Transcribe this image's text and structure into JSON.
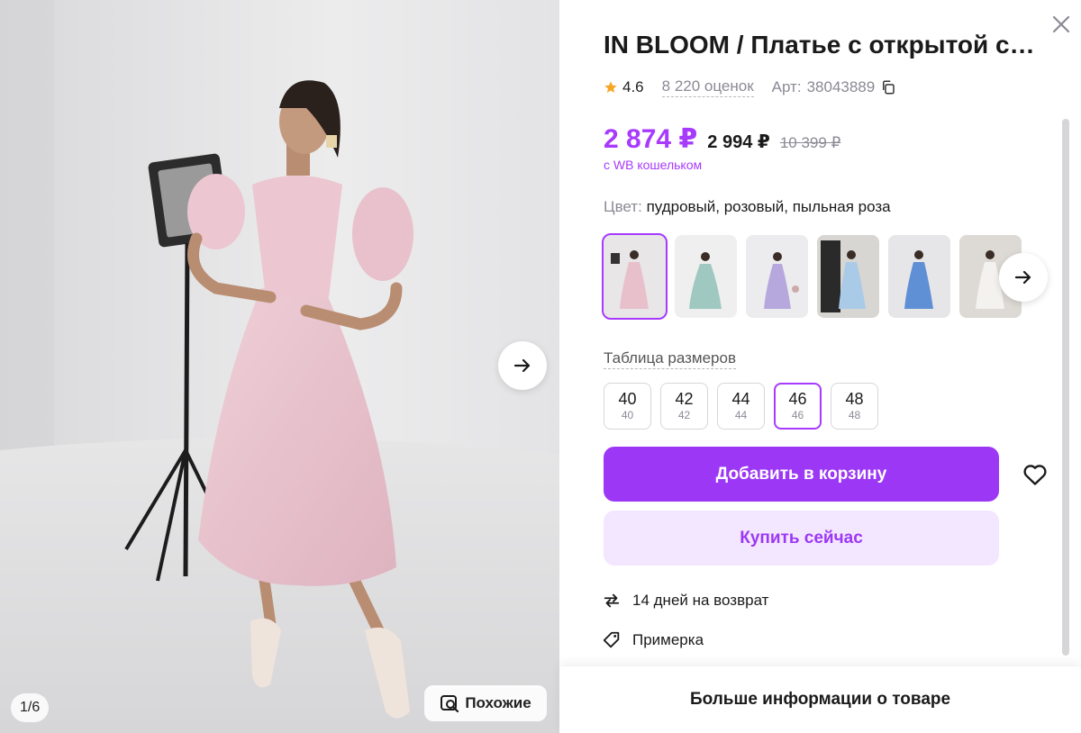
{
  "gallery": {
    "counter": "1/6",
    "similar_label": "Похожие",
    "next_icon": "arrow-right-icon",
    "similar_icon": "image-search-icon"
  },
  "product": {
    "title": "IN BLOOM / Платье с открытой спиной",
    "rating": "4.6",
    "reviews": "8 220 оценок",
    "article_label": "Арт:",
    "article": "38043889",
    "price_main": "2 874 ₽",
    "price_second": "2 994 ₽",
    "price_old": "10 399 ₽",
    "wallet_note": "с WB кошельком",
    "color_label": "Цвет:",
    "color_value": "пудровый, розовый, пыльная роза",
    "color_variants": [
      "pink",
      "mint",
      "lavender",
      "light-blue",
      "blue",
      "white"
    ],
    "size_table_label": "Таблица размеров",
    "sizes": [
      {
        "ru": "40",
        "alt": "40",
        "selected": false
      },
      {
        "ru": "42",
        "alt": "42",
        "selected": false
      },
      {
        "ru": "44",
        "alt": "44",
        "selected": false
      },
      {
        "ru": "46",
        "alt": "46",
        "selected": true
      },
      {
        "ru": "48",
        "alt": "48",
        "selected": false
      }
    ],
    "add_to_cart_label": "Добавить в корзину",
    "buy_now_label": "Купить сейчас",
    "features": [
      {
        "icon": "return-arrows-icon",
        "label": "14 дней на возврат"
      },
      {
        "icon": "tag-icon",
        "label": "Примерка"
      }
    ],
    "more_info_label": "Больше информации о товаре"
  },
  "colors": {
    "accent": "#9c38f5",
    "accent_light": "#f3e6ff",
    "price": "#a73afd",
    "star": "#f5a623"
  }
}
